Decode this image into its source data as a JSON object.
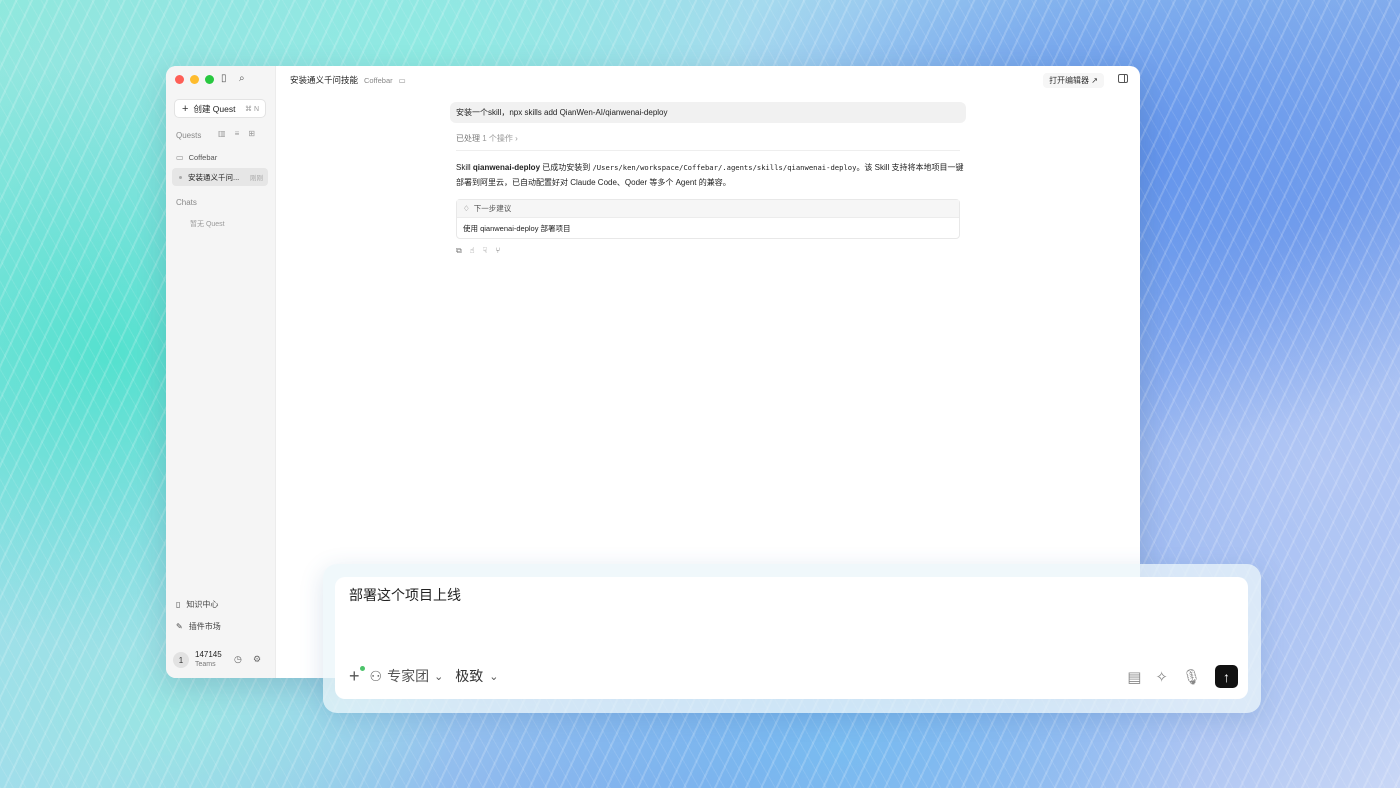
{
  "sidebar": {
    "new_quest_label": "创建 Quest",
    "new_quest_shortcut": "⌘ N",
    "quests_heading": "Quests",
    "project_name": "Coffebar",
    "active_quest": {
      "title": "安装通义千问...",
      "time": "刚刚"
    },
    "chats_heading": "Chats",
    "chats_empty": "暂无 Quest",
    "knowledge_center": "知识中心",
    "plugin_market": "插件市场",
    "user": {
      "avatar_text": "1",
      "name": "147145",
      "team": "Teams"
    }
  },
  "header": {
    "title": "安装通义千问技能",
    "project": "Coffebar",
    "open_editor": "打开编辑器"
  },
  "conversation": {
    "user_message": "安装一个skill，npx skills add QianWen-AI/qianwenai-deploy",
    "processed_label": "已处理",
    "processed_count": "1 个操作",
    "answer": {
      "prefix": "Skill ",
      "skill_name": "qianwenai-deploy",
      "mid": " 已成功安装到 ",
      "path": "/Users/ken/workspace/Coffebar/.agents/skills/qianwenai-deploy",
      "suffix": "。该 Skill 支持将本地项目一键部署到阿里云，已自动配置好对 Claude Code、Qoder 等多个 Agent 的兼容。"
    },
    "suggestion_heading": "下一步建议",
    "suggestion_item": "使用 qianwenai-deploy 部署项目"
  },
  "composer": {
    "input_value": "部署这个项目上线",
    "expert_team": "专家团",
    "speed_mode": "极致"
  },
  "icons": {
    "search": "search-icon",
    "sidebar_toggle": "sidebar-toggle-icon",
    "send": "arrow-up-icon"
  },
  "colors": {
    "send_button": "#111111",
    "status_dot": "#4cc36a"
  }
}
